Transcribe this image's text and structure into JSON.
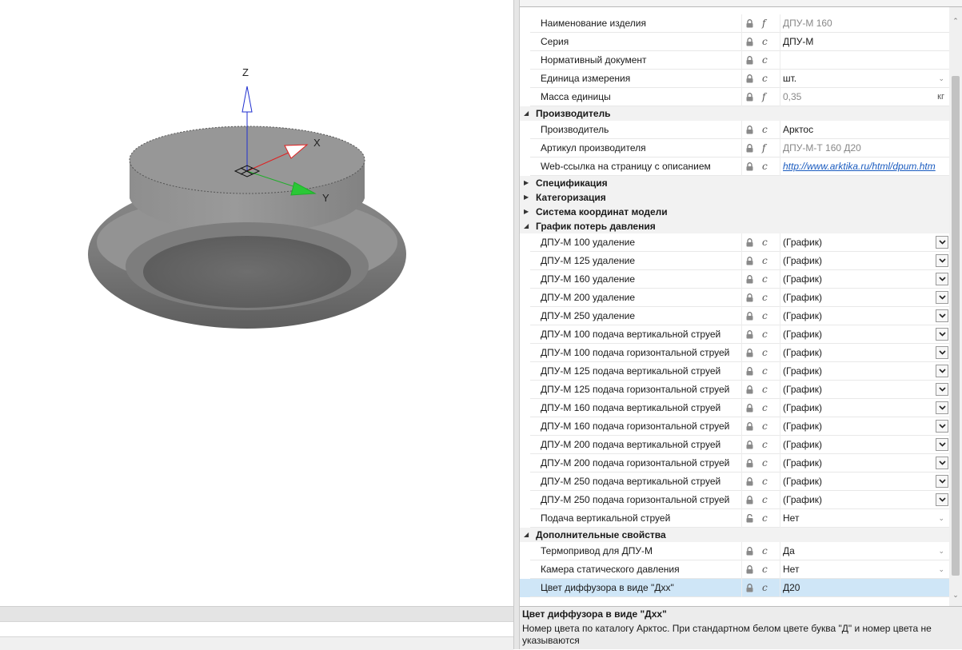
{
  "viewport": {
    "axis_z": "Z",
    "axis_x": "X",
    "axis_y": "Y",
    "colors": {
      "x_axis": "#e02020",
      "y_axis": "#1fae2a",
      "z_axis": "#2030d0",
      "model": "#8c8c8c"
    }
  },
  "rows_top": [
    {
      "label": "Наименование изделия",
      "flag": "f",
      "value": "ДПУ-М 160",
      "value_style": "grey"
    },
    {
      "label": "Серия",
      "flag": "c",
      "value": "ДПУ-М"
    },
    {
      "label": "Нормативный документ",
      "flag": "c",
      "value": ""
    },
    {
      "label": "Единица измерения",
      "flag": "c",
      "value": "шт.",
      "dropdown": "chevron"
    },
    {
      "label": "Масса единицы",
      "flag": "f",
      "value": "0,35",
      "value_style": "grey",
      "unit": "кг"
    }
  ],
  "categories": {
    "manufacturer": "Производитель",
    "specification": "Спецификация",
    "categorization": "Категоризация",
    "coordinate_system": "Система координат модели",
    "pressure_loss": "График потерь давления",
    "additional": "Дополнительные свойства"
  },
  "rows_manufacturer": [
    {
      "label": "Производитель",
      "flag": "c",
      "value": "Арктос"
    },
    {
      "label": "Артикул производителя",
      "flag": "f",
      "value": "ДПУ-М-Т 160 Д20",
      "value_style": "grey"
    },
    {
      "label": "Web-ссылка на страницу с описанием",
      "flag": "c",
      "value": "http://www.arktika.ru/html/dpum.htm",
      "value_style": "link"
    }
  ],
  "rows_pressure": [
    {
      "label": "ДПУ-М 100 удаление",
      "flag": "c",
      "value": "(График)"
    },
    {
      "label": "ДПУ-М 125 удаление",
      "flag": "c",
      "value": "(График)"
    },
    {
      "label": "ДПУ-М 160 удаление",
      "flag": "c",
      "value": "(График)"
    },
    {
      "label": "ДПУ-М 200 удаление",
      "flag": "c",
      "value": "(График)"
    },
    {
      "label": "ДПУ-М 250 удаление",
      "flag": "c",
      "value": "(График)"
    },
    {
      "label": "ДПУ-М 100 подача вертикальной струей",
      "flag": "c",
      "value": "(График)"
    },
    {
      "label": "ДПУ-М 100 подача горизонтальной струей",
      "flag": "c",
      "value": "(График)"
    },
    {
      "label": "ДПУ-М 125 подача вертикальной струей",
      "flag": "c",
      "value": "(График)"
    },
    {
      "label": "ДПУ-М 125 подача горизонтальной струей",
      "flag": "c",
      "value": "(График)"
    },
    {
      "label": "ДПУ-М 160 подача вертикальной струей",
      "flag": "c",
      "value": "(График)"
    },
    {
      "label": "ДПУ-М 160 подача горизонтальной струей",
      "flag": "c",
      "value": "(График)"
    },
    {
      "label": "ДПУ-М 200 подача вертикальной струей",
      "flag": "c",
      "value": "(График)"
    },
    {
      "label": "ДПУ-М 200 подача горизонтальной струей",
      "flag": "c",
      "value": "(График)"
    },
    {
      "label": "ДПУ-М 250 подача вертикальной струей",
      "flag": "c",
      "value": "(График)"
    },
    {
      "label": "ДПУ-М 250 подача горизонтальной струей",
      "flag": "c",
      "value": "(График)"
    },
    {
      "label": "Подача вертикальной струей",
      "flag": "c",
      "value": "Нет",
      "lock": "open",
      "dropdown": "chevron"
    }
  ],
  "rows_additional": [
    {
      "label": "Термопривод для ДПУ-М",
      "flag": "c",
      "value": "Да",
      "dropdown": "chevron"
    },
    {
      "label": "Камера статического давления",
      "flag": "c",
      "value": "Нет",
      "dropdown": "chevron"
    },
    {
      "label": "Цвет диффузора в виде \"Дхх\"",
      "flag": "c",
      "value": "Д20",
      "selected": true
    }
  ],
  "description": {
    "title": "Цвет диффузора в виде \"Дхх\"",
    "text": "Номер цвета по каталогу Арктос. При стандартном белом цвете буква \"Д\" и номер цвета не указываются"
  }
}
